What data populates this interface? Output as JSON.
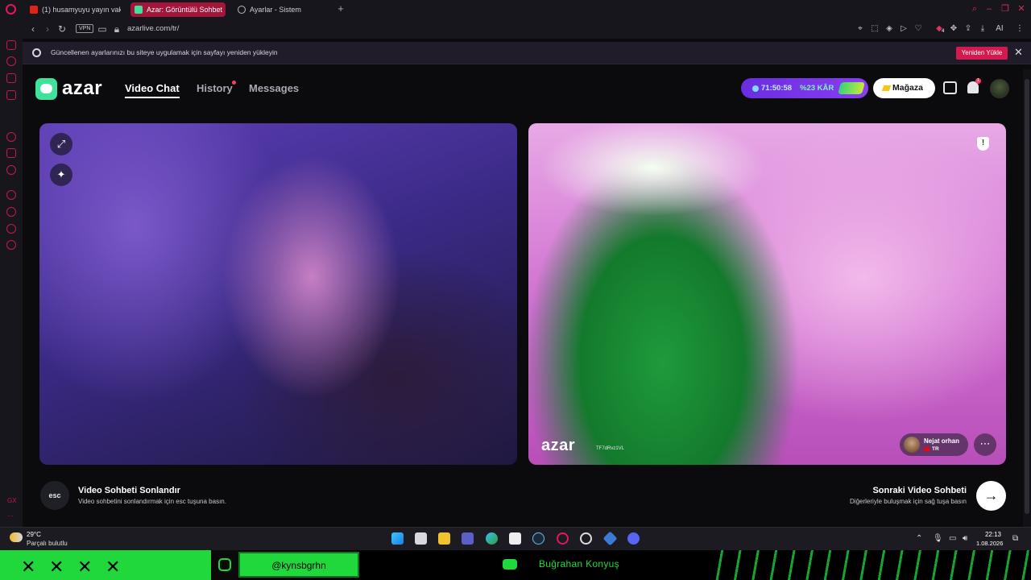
{
  "browser": {
    "tabs": [
      {
        "label": "(1) husamyuyu yayın vakti",
        "active": false
      },
      {
        "label": "Azar: Görüntülü Sohbet",
        "active": true
      },
      {
        "label": "Ayarlar - Sistem",
        "active": false
      }
    ],
    "new_tab": "+",
    "vpn_badge": "VPN",
    "url": "azarlive.com/tr/",
    "ai_label": "AI",
    "extension_badge": "4"
  },
  "notification": {
    "text": "Güncellenen ayarlarınızı bu siteye uygulamak için sayfayı yeniden yükleyin",
    "reload_label": "Yeniden Yükle",
    "close": "✕"
  },
  "app": {
    "logo": "azar",
    "nav": [
      {
        "label": "Video Chat",
        "active": true
      },
      {
        "label": "History",
        "active": false,
        "has_dot": true
      },
      {
        "label": "Messages",
        "active": false
      }
    ],
    "promo": {
      "timer": "71:50:58",
      "discount": "%23 KÂR"
    },
    "shop_label": "Mağaza",
    "bell_badge": "1"
  },
  "video": {
    "watermark": "azar",
    "session_id": "TF7dRvz1VL",
    "partner": {
      "name": "Nejat orhan",
      "country": "TR"
    }
  },
  "controls": {
    "esc_key": "esc",
    "end_title": "Video Sohbeti Sonlandır",
    "end_desc": "Video sohbetini sonlandırmak için esc tuşuna basın.",
    "next_title": "Sonraki Video Sohbeti",
    "next_desc": "Diğerleriyle buluşmak için sağ tuşa basın",
    "next_arrow": "→"
  },
  "taskbar": {
    "weather_temp": "29°C",
    "weather_condition": "Parçalı bulutlu",
    "time": "22:13",
    "date": "1.08.2026"
  },
  "overlay": {
    "instagram_handle": "@kynsbgrhn",
    "youtube_name": "Buğrahan Konyuş",
    "x_marks": [
      "✕",
      "✕",
      "✕",
      "✕"
    ]
  },
  "colors": {
    "accent": "#d11a4e",
    "azar_green": "#3ee29a",
    "overlay_green": "#21d83c",
    "promo_purple": "#7b34e8"
  }
}
